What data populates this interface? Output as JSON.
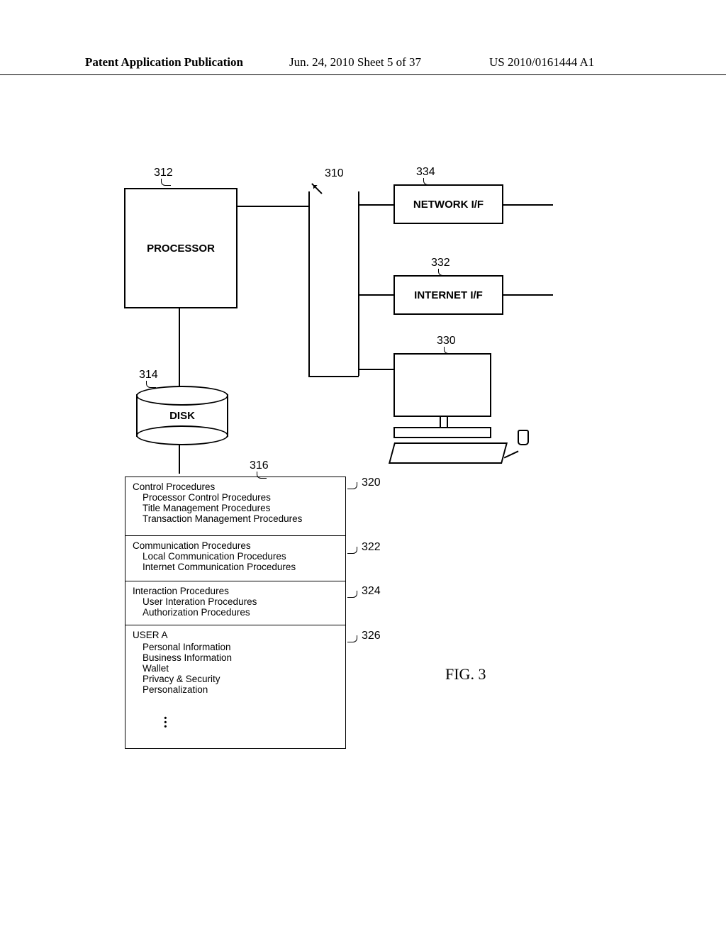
{
  "header": {
    "left": "Patent Application Publication",
    "center": "Jun. 24, 2010  Sheet 5 of 37",
    "right": "US 2010/0161444 A1"
  },
  "figure_label": "FIG. 3",
  "refs": {
    "processor": "312",
    "bus": "310",
    "disk": "314",
    "panel_head": "316",
    "net_if": "334",
    "inet_if": "332",
    "terminal": "330",
    "p_control": "320",
    "p_comm": "322",
    "p_inter": "324",
    "p_user": "326"
  },
  "blocks": {
    "processor": "PROCESSOR",
    "disk": "DISK",
    "net_if": "NETWORK I/F",
    "inet_if": "INTERNET I/F"
  },
  "panels": {
    "control": {
      "title": "Control Procedures",
      "items": [
        "Processor Control Procedures",
        "Title Management Procedures",
        "Transaction Management Procedures"
      ]
    },
    "comm": {
      "title": "Communication Procedures",
      "items": [
        "Local Communication Procedures",
        "Internet Communication Procedures"
      ]
    },
    "inter": {
      "title": "Interaction Procedures",
      "items": [
        "User Interation Procedures",
        "Authorization Procedures"
      ]
    },
    "user": {
      "title": "USER A",
      "items": [
        "Personal Information",
        "Business Information",
        "Wallet",
        "Privacy & Security",
        "Personalization"
      ]
    }
  }
}
